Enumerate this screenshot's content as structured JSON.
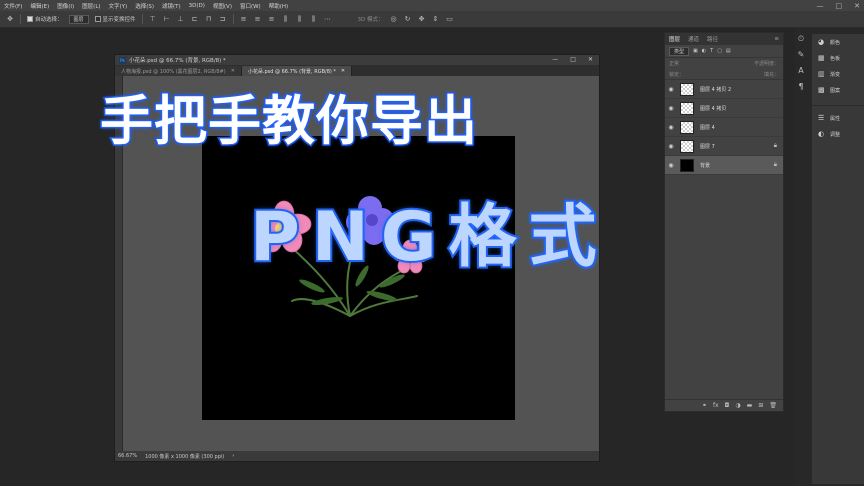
{
  "menubar": {
    "items": [
      "文件(F)",
      "编辑(E)",
      "图像(I)",
      "图层(L)",
      "文字(Y)",
      "选择(S)",
      "滤镜(T)",
      "3D(D)",
      "视图(V)",
      "窗口(W)",
      "帮助(H)"
    ],
    "window_controls": [
      "—",
      "□",
      "✕"
    ]
  },
  "options": {
    "auto_select_label": "自动选择：",
    "auto_select_value": "图层",
    "show_transform_label": "显示变换控件",
    "mode_3d_label": "3D 模式："
  },
  "document": {
    "window_title": "小花朵.psd @ 66.7% (背景, RGB/8) *",
    "tabs": [
      {
        "label": "人物海报.psd @ 100% (黑花图层2, RGB/8#)",
        "active": false
      },
      {
        "label": "小花朵.psd @ 66.7% (背景, RGB/8) *",
        "active": true
      }
    ],
    "zoom": "66.67%",
    "doc_info": "1000 像素 x 1000 像素 (300 ppi)"
  },
  "overlay": {
    "title_line1": "手把手教你导出",
    "title_line2": "PNG格式"
  },
  "layers_panel": {
    "tabs": [
      "图层",
      "通道",
      "路径"
    ],
    "filter_label": "类型",
    "blend_mode": "正常",
    "opacity_label": "不透明度：",
    "lock_label": "锁定：",
    "fill_label": "填充：",
    "layers": [
      {
        "name": "图层 4 拷贝 2",
        "locked": false,
        "selected": false
      },
      {
        "name": "图层 4 拷贝",
        "locked": false,
        "selected": false
      },
      {
        "name": "图层 4",
        "locked": false,
        "selected": false
      },
      {
        "name": "图层 7",
        "locked": true,
        "selected": false
      },
      {
        "name": "背景",
        "locked": true,
        "selected": true
      }
    ]
  },
  "side_panels": {
    "group1": [
      "颜色",
      "色板",
      "渐变",
      "图案"
    ],
    "group2": [
      "属性",
      "调整"
    ]
  },
  "colors": {
    "accent_blue": "#1e62f0",
    "petal_pink": "#f08ab8",
    "petal_purple": "#7b6cf0"
  }
}
